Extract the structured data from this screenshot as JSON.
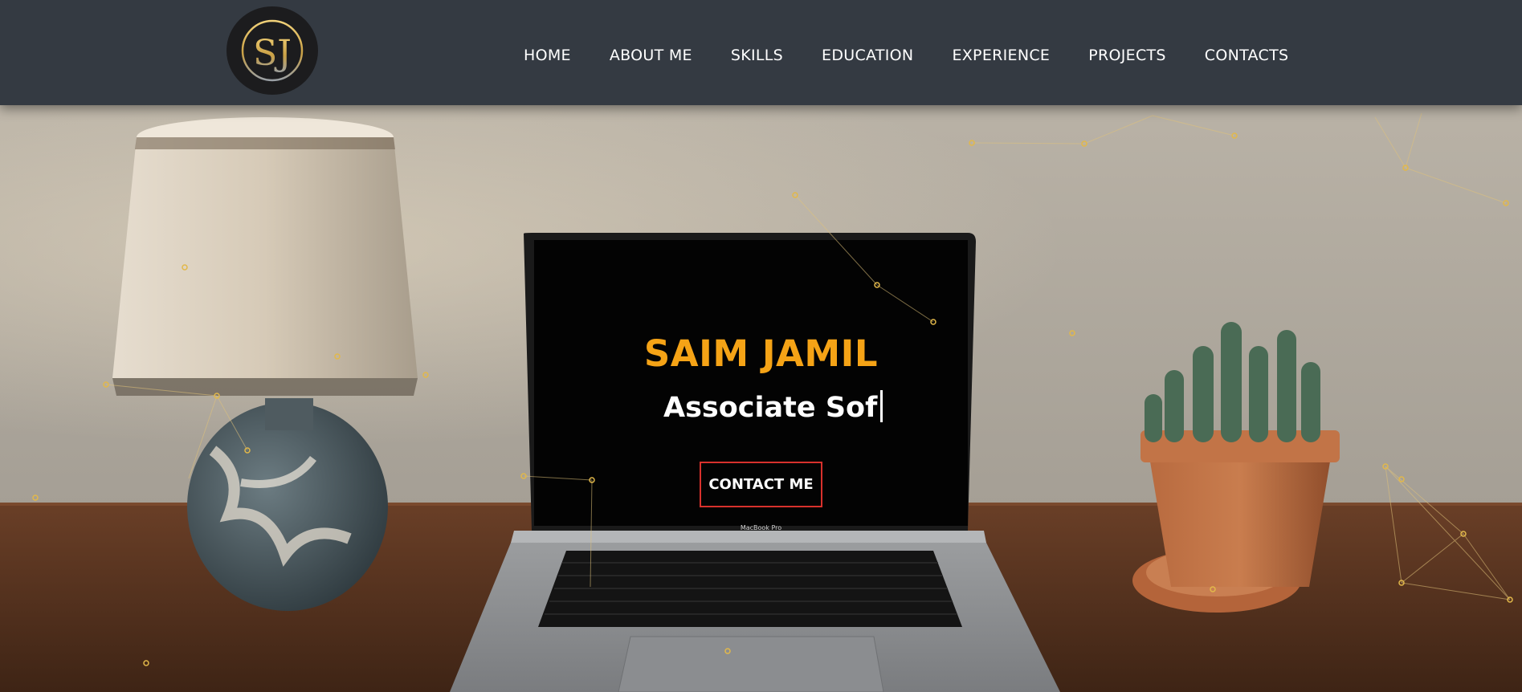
{
  "logo": {
    "text": "SJ",
    "icon": "sj-monogram-logo"
  },
  "nav": {
    "items": [
      {
        "label": "HOME"
      },
      {
        "label": "ABOUT ME"
      },
      {
        "label": "SKILLS"
      },
      {
        "label": "EDUCATION"
      },
      {
        "label": "EXPERIENCE"
      },
      {
        "label": "PROJECTS"
      },
      {
        "label": "CONTACTS"
      }
    ]
  },
  "hero": {
    "name": "SAIM JAMIL",
    "role_typed": "Associate Sof",
    "cta_label": "CONTACT ME",
    "laptop_brand": "MacBook Pro"
  },
  "colors": {
    "navbar_bg": "#343a42",
    "accent_orange": "#f5a316",
    "cta_border": "#d8312c",
    "particle": "#e0b64a"
  }
}
